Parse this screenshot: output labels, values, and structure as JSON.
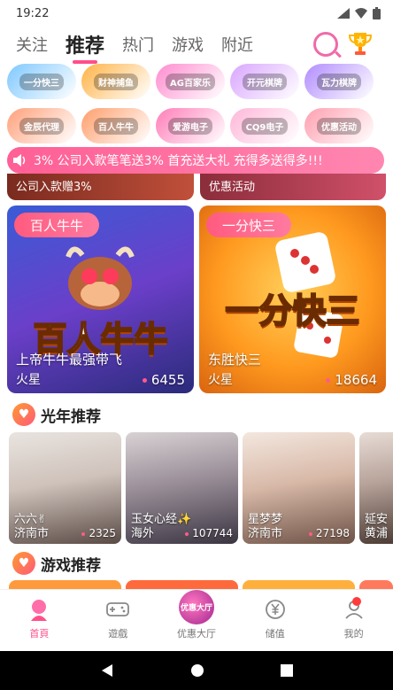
{
  "status_bar": {
    "time": "19:22"
  },
  "top_tabs": [
    "关注",
    "推荐",
    "热门",
    "游戏",
    "附近"
  ],
  "active_tab": "推荐",
  "accent_color": "#ff4f8a",
  "categories": [
    {
      "label": "一分快三",
      "color": "#7ec8ff"
    },
    {
      "label": "财神捕鱼",
      "color": "#ffb347"
    },
    {
      "label": "AG百家乐",
      "color": "#ff8ccf"
    },
    {
      "label": "开元棋牌",
      "color": "#d9a6ff"
    },
    {
      "label": "瓦力棋牌",
      "color": "#b18cff"
    },
    {
      "label": "金辰代理",
      "color": "#ffa07a"
    },
    {
      "label": "百人牛牛",
      "color": "#ff9e6b"
    },
    {
      "label": "爱游电子",
      "color": "#ff7db8"
    },
    {
      "label": "CQ9电子",
      "color": "#ffb7d9"
    },
    {
      "label": "优惠活动",
      "color": "#ff9fb0"
    }
  ],
  "announcement": "3% 公司入款笔笔送3% 首充送大礼 充得多送得多!!!",
  "promo_strips": [
    "公司入款赠3%",
    "优惠活动"
  ],
  "game_cards": [
    {
      "tag": "百人牛牛",
      "big_text": "百人牛牛",
      "title": "上帝牛牛最强带飞",
      "location": "火星",
      "count": "6455"
    },
    {
      "tag": "一分快三",
      "big_text": "一分快三",
      "title": "东胜快三",
      "location": "火星",
      "count": "18664"
    }
  ],
  "sections": {
    "streamers_title": "光年推荐",
    "games_title": "游戏推荐"
  },
  "streamers": [
    {
      "name": "六六✌",
      "location": "济南市",
      "count": "2325"
    },
    {
      "name": "玉女心经✨",
      "location": "海外",
      "count": "107744"
    },
    {
      "name": "星梦梦",
      "location": "济南市",
      "count": "27198"
    },
    {
      "name": "延安",
      "location": "黄浦",
      "count": ""
    }
  ],
  "bottom_nav": [
    {
      "label": "首頁",
      "icon": "home-icon"
    },
    {
      "label": "遊戲",
      "icon": "gamepad-icon"
    },
    {
      "label": "优惠大厅",
      "icon": "promo-hall-icon",
      "badge_text": "优惠大厅"
    },
    {
      "label": "储值",
      "icon": "yen-icon"
    },
    {
      "label": "我的",
      "icon": "profile-icon"
    }
  ]
}
